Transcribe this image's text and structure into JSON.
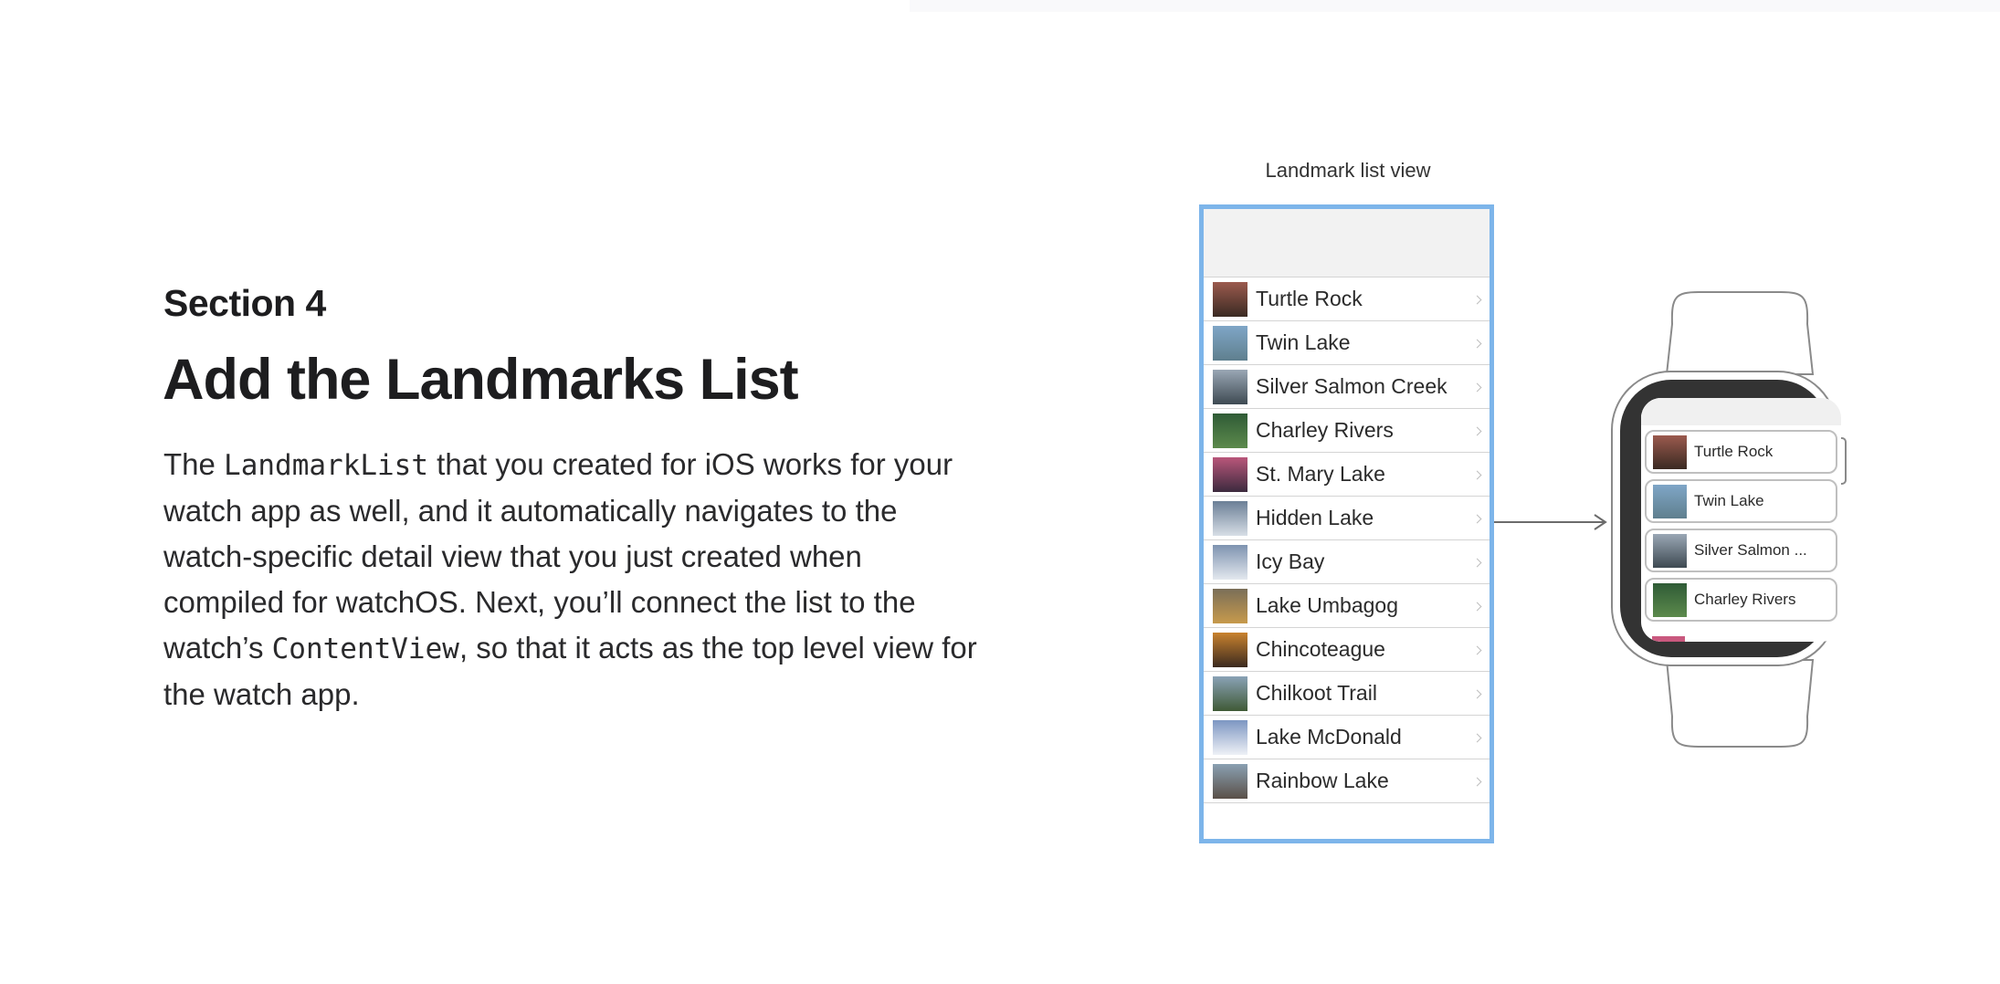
{
  "section": {
    "label": "Section 4",
    "title": "Add the Landmarks List"
  },
  "intro": {
    "p1": "The ",
    "code1": "LandmarkList",
    "p2": " that you created for iOS works for your watch app as well, and it automatically navigates to the watch-specific detail view that you just created when compiled for watchOS. Next, you’ll connect the list to the watch’s ",
    "code2": "ContentView",
    "p3": ", so that it acts as the top level view for the watch app."
  },
  "diagram": {
    "caption": "Landmark list view",
    "accent_color": "#7db5ea",
    "landmarks": [
      "Turtle Rock",
      "Twin Lake",
      "Silver Salmon Creek",
      "Charley Rivers",
      "St. Mary Lake",
      "Hidden Lake",
      "Icy Bay",
      "Lake Umbagog",
      "Chincoteague",
      "Chilkoot Trail",
      "Lake McDonald",
      "Rainbow Lake"
    ],
    "thumb_colors": [
      [
        "#9b5a4e",
        "#3a2a22"
      ],
      [
        "#7fa6c7",
        "#5f7f8e"
      ],
      [
        "#9aa7b5",
        "#3e4a52"
      ],
      [
        "#2f5b36",
        "#5c8a4c"
      ],
      [
        "#b9567a",
        "#3c2a3e"
      ],
      [
        "#6b7f96",
        "#d7dee6"
      ],
      [
        "#7e93b0",
        "#e3e8ee"
      ],
      [
        "#7a6e58",
        "#c79a4c"
      ],
      [
        "#c9822e",
        "#3b2a1f"
      ],
      [
        "#8aa2b6",
        "#3f5a36"
      ],
      [
        "#7d96c2",
        "#eef1f6"
      ],
      [
        "#8aa0b2",
        "#5a5048"
      ]
    ],
    "watch_items": [
      "Turtle Rock",
      "Twin Lake",
      "Silver Salmon ...",
      "Charley Rivers"
    ]
  }
}
